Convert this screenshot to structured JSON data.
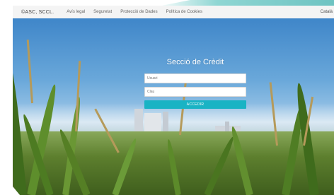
{
  "header": {
    "brand": "©ASC, SCCL.",
    "nav": [
      "Avís legal",
      "Seguretat",
      "Protecció de Dades",
      "Política de Cookies"
    ],
    "right": "Català"
  },
  "login": {
    "title": "Secció de Crèdit",
    "user_placeholder": "Usuari",
    "password_placeholder": "Clau",
    "submit_label": "ACCEDIR"
  },
  "colors": {
    "accent": "#19b3c4",
    "topbar_bg": "#f4f4f4"
  }
}
